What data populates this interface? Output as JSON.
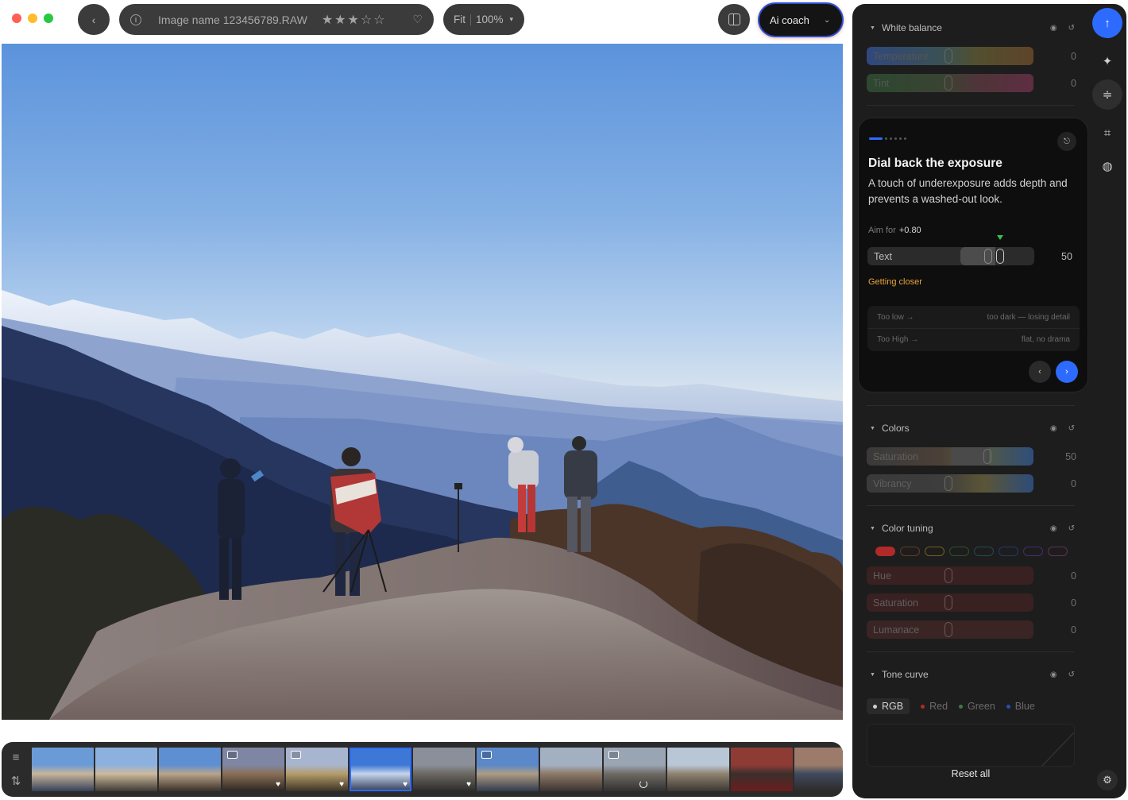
{
  "window": {
    "traffic_lights": [
      "close",
      "minimize",
      "zoom"
    ]
  },
  "topbar": {
    "back_icon": "chevron-left-icon",
    "info_icon": "i",
    "image_name": "Image name 123456789.RAW",
    "rating": 3,
    "rating_max": 5,
    "stars": [
      "★",
      "★",
      "★",
      "☆",
      "☆"
    ],
    "heart": "♡",
    "fit_label": "Fit",
    "zoom_label": "100%",
    "zoom_caret": "▾",
    "coach_label": "Ai coach",
    "coach_chevron": "⌄"
  },
  "filmstrip": {
    "filter_icon": "≡",
    "sort_icon": "⇅",
    "thumbnails": [
      {
        "edited": false,
        "favorite": false,
        "selected": false,
        "loading": false
      },
      {
        "edited": false,
        "favorite": false,
        "selected": false,
        "loading": false
      },
      {
        "edited": false,
        "favorite": false,
        "selected": false,
        "loading": false
      },
      {
        "edited": true,
        "favorite": true,
        "selected": false,
        "loading": false
      },
      {
        "edited": true,
        "favorite": true,
        "selected": false,
        "loading": false
      },
      {
        "edited": false,
        "favorite": true,
        "selected": true,
        "loading": false
      },
      {
        "edited": false,
        "favorite": true,
        "selected": false,
        "loading": false
      },
      {
        "edited": true,
        "favorite": false,
        "selected": false,
        "loading": false
      },
      {
        "edited": false,
        "favorite": false,
        "selected": false,
        "loading": false
      },
      {
        "edited": true,
        "favorite": false,
        "selected": false,
        "loading": true
      },
      {
        "edited": false,
        "favorite": false,
        "selected": false,
        "loading": false
      },
      {
        "edited": false,
        "favorite": false,
        "selected": false,
        "loading": false
      },
      {
        "edited": false,
        "favorite": false,
        "selected": false,
        "loading": false
      }
    ]
  },
  "panel": {
    "white_balance": {
      "title": "White balance",
      "temperature": {
        "label": "Temperature",
        "value": "0"
      },
      "tint": {
        "label": "Tint",
        "value": "0"
      }
    },
    "coach": {
      "step": 1,
      "steps_total": 6,
      "exit_icon": "⎋",
      "title": "Dial back the exposure",
      "description": "A touch of underexposure adds depth and prevents a washed-out look.",
      "aim_label": "Aim for",
      "aim_value": "+0.80",
      "slider_label": "Text",
      "slider_value": "50",
      "status": "Getting closer",
      "hint_low_label": "Too low →",
      "hint_low_text": "too dark — losing detail",
      "hint_high_label": "Too High →",
      "hint_high_text": "flat, no drama",
      "prev": "‹",
      "next": "›"
    },
    "colors": {
      "title": "Colors",
      "saturation": {
        "label": "Saturation",
        "value": "50"
      },
      "vibrancy": {
        "label": "Vibrancy",
        "value": "0"
      }
    },
    "color_tuning": {
      "title": "Color tuning",
      "chips": [
        "#b02a2a",
        "#a0522d",
        "#b8922a",
        "#3d7a3d",
        "#2a6e8a",
        "#2a4db0",
        "#6a3ab0",
        "#a03a8a"
      ],
      "hue": {
        "label": "Hue",
        "value": "0"
      },
      "saturation": {
        "label": "Saturation",
        "value": "0"
      },
      "luminance": {
        "label": "Lumanace",
        "value": "0"
      }
    },
    "tone_curve": {
      "title": "Tone curve",
      "tabs": [
        {
          "label": "RGB",
          "color": "#d0d0d0"
        },
        {
          "label": "Red",
          "color": "#b02a2a"
        },
        {
          "label": "Green",
          "color": "#3d7a3d"
        },
        {
          "label": "Blue",
          "color": "#2a4db0"
        }
      ]
    },
    "reset_label": "Reset all"
  },
  "rail": {
    "upload_icon": "↑",
    "tools": [
      "auto-fix-icon",
      "adjust-icon",
      "crop-icon",
      "mask-icon"
    ],
    "settings_icon": "⚙"
  },
  "colors": {
    "accent": "#2d6bff",
    "status_warning": "#e8a33d",
    "marker": "#39c04b"
  }
}
